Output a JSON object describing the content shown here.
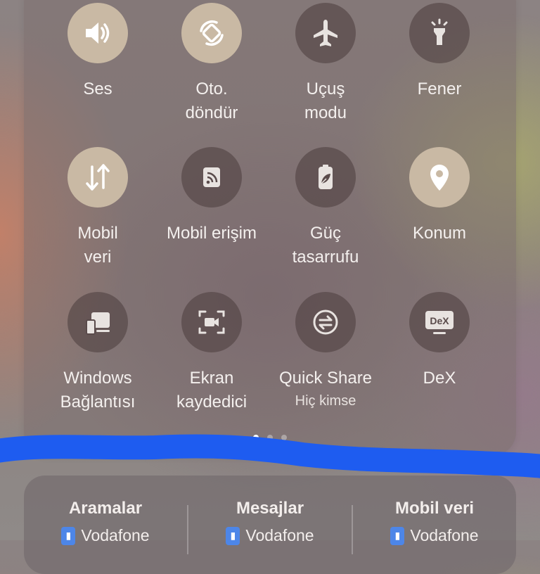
{
  "quick_tiles": [
    {
      "label": "Ses",
      "sub": "",
      "icon": "speaker-icon",
      "state": "on"
    },
    {
      "label": "Oto.\ndöndür",
      "sub": "",
      "icon": "auto-rotate-icon",
      "state": "on"
    },
    {
      "label": "Uçuş\nmodu",
      "sub": "",
      "icon": "airplane-icon",
      "state": "off"
    },
    {
      "label": "Fener",
      "sub": "",
      "icon": "flashlight-icon",
      "state": "off"
    },
    {
      "label": "Mobil\nveri",
      "sub": "",
      "icon": "mobile-data-icon",
      "state": "on"
    },
    {
      "label": "Mobil erişim",
      "sub": "",
      "icon": "hotspot-icon",
      "state": "off"
    },
    {
      "label": "Güç\ntasarrufu",
      "sub": "",
      "icon": "power-saving-icon",
      "state": "off"
    },
    {
      "label": "Konum",
      "sub": "",
      "icon": "location-icon",
      "state": "on"
    },
    {
      "label": "Windows\nBağlantısı",
      "sub": "",
      "icon": "link-to-windows-icon",
      "state": "off"
    },
    {
      "label": "Ekran\nkaydedici",
      "sub": "",
      "icon": "screen-recorder-icon",
      "state": "off"
    },
    {
      "label": "Quick Share",
      "sub": "Hiç kimse",
      "icon": "quick-share-icon",
      "state": "off"
    },
    {
      "label": "DeX",
      "sub": "",
      "icon": "dex-icon",
      "state": "off"
    }
  ],
  "page_indicator": {
    "pages": 3,
    "current": 1
  },
  "sim": [
    {
      "title": "Aramalar",
      "value": "Vodafone"
    },
    {
      "title": "Mesajlar",
      "value": "Vodafone"
    },
    {
      "title": "Mobil veri",
      "value": "Vodafone"
    }
  ],
  "colors": {
    "tile_on": "#c9b9a4",
    "tile_off": "#504242",
    "scribble": "#1e5cf0",
    "sim_badge": "#4d86e8"
  }
}
